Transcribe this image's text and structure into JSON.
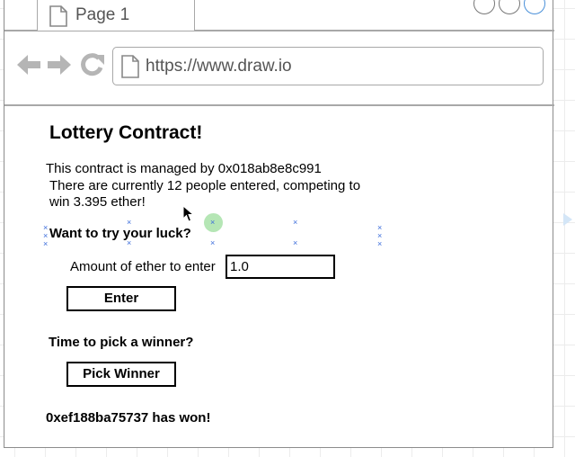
{
  "tab": {
    "label": "Page 1"
  },
  "address_bar": {
    "url": "https://www.draw.io"
  },
  "icons": [
    "page-icon",
    "back-arrow-icon",
    "forward-arrow-icon",
    "reload-icon",
    "document-icon",
    "window-control-icon",
    "cursor-icon",
    "expand-arrow-icon",
    "selection-handle-icon",
    "rotate-handle-icon"
  ],
  "mockup": {
    "title": "Lottery Contract!",
    "manager_line": "This contract is managed by 0x018ab8e8c991",
    "entered_line1": "There are currently 12 people entered, competing to",
    "entered_line2": "win 3.395 ether!",
    "try_luck_heading": "Want to try your luck?",
    "amount_label": "Amount of ether to enter",
    "amount_value": "1.0",
    "enter_button": "Enter",
    "pick_heading": "Time to pick a winner?",
    "pick_button": "Pick Winner",
    "winner_text": "0xef188ba75737 has won!"
  },
  "colors": {
    "selection": "#3c6ddb",
    "rotate_handle": "#8fd48f",
    "border": "#a8a8a8",
    "canvas_grid": "#ececec"
  }
}
